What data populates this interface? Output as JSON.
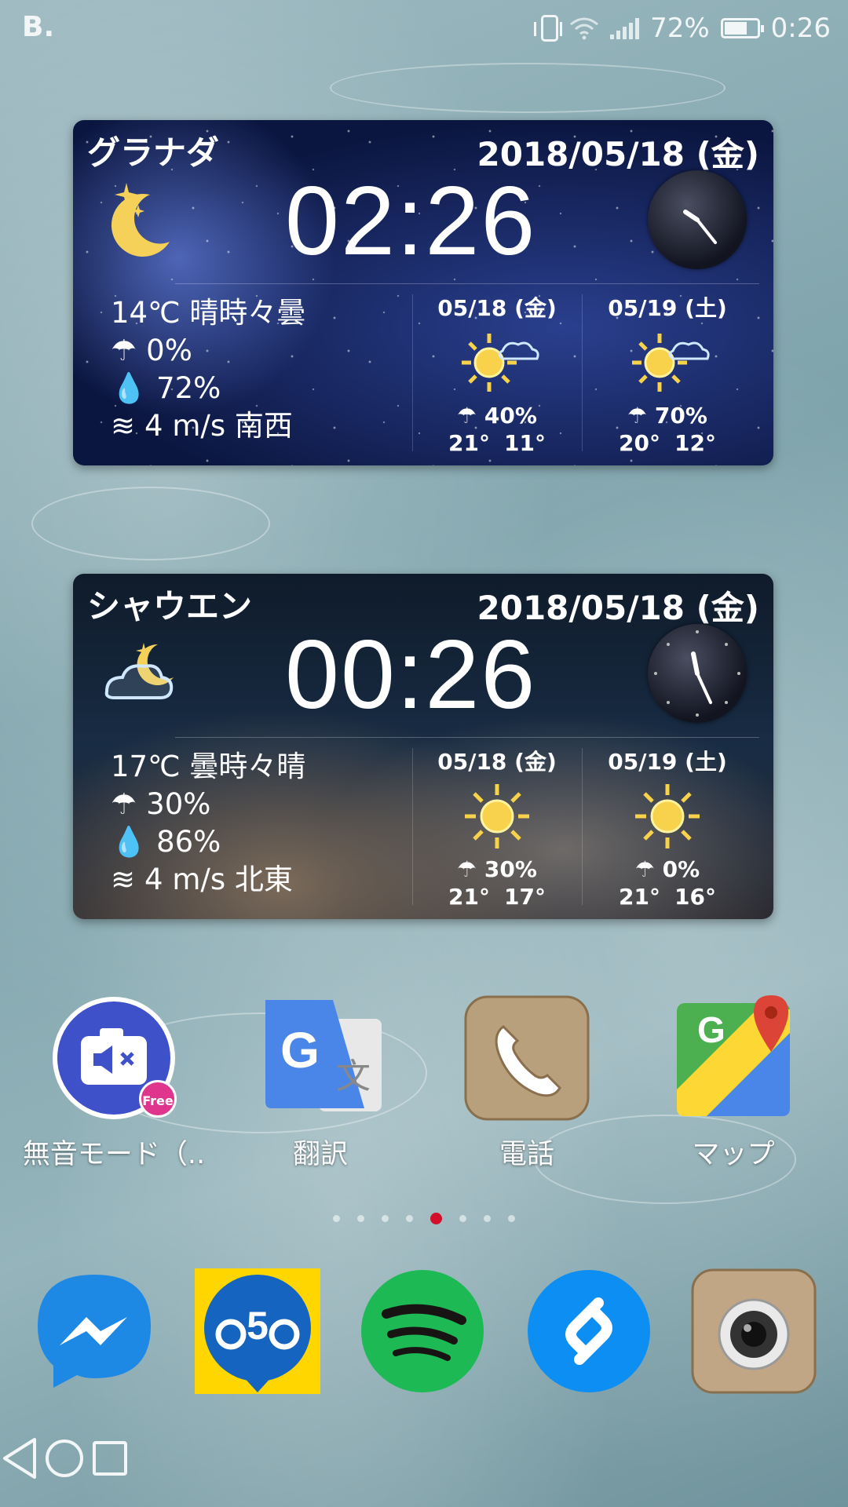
{
  "status": {
    "app_badge": "B.",
    "battery": "72%",
    "battery_level": 0.72,
    "time": "0:26"
  },
  "widgets": [
    {
      "city": "グラナダ",
      "date": "2018/05/18 (金)",
      "time": "02:26",
      "current_icon": "moon-stars-icon",
      "current": {
        "temp_cond": "14℃ 晴時々曇",
        "rain": "0%",
        "humidity": "72%",
        "wind": "4 m/s 南西"
      },
      "forecast": [
        {
          "date": "05/18 (金)",
          "icon": "sun-cloud-icon",
          "rain": "40%",
          "high": "21°",
          "low": "11°"
        },
        {
          "date": "05/19 (土)",
          "icon": "sun-cloud-icon",
          "rain": "70%",
          "high": "20°",
          "low": "12°"
        }
      ]
    },
    {
      "city": "シャウエン",
      "date": "2018/05/18 (金)",
      "time": "00:26",
      "current_icon": "cloud-moon-icon",
      "current": {
        "temp_cond": "17℃ 曇時々晴",
        "rain": "30%",
        "humidity": "86%",
        "wind": "4 m/s 北東"
      },
      "forecast": [
        {
          "date": "05/18 (金)",
          "icon": "sun-icon",
          "rain": "30%",
          "high": "21°",
          "low": "17°"
        },
        {
          "date": "05/19 (土)",
          "icon": "sun-icon",
          "rain": "0%",
          "high": "21°",
          "low": "16°"
        }
      ]
    }
  ],
  "apps": [
    {
      "label": "無音モード（..",
      "icon": "silent-camera-icon",
      "badge": "Free"
    },
    {
      "label": "翻訳",
      "icon": "google-translate-icon"
    },
    {
      "label": "電話",
      "icon": "phone-icon"
    },
    {
      "label": "マップ",
      "icon": "google-maps-icon"
    }
  ],
  "page_dots": {
    "count": 8,
    "active": 5
  },
  "dock": [
    {
      "icon": "messenger-icon"
    },
    {
      "icon": "o5o-icon"
    },
    {
      "icon": "spotify-icon"
    },
    {
      "icon": "shazam-icon"
    },
    {
      "icon": "camera-icon"
    }
  ],
  "nav": [
    "back-icon",
    "home-icon",
    "recents-icon"
  ]
}
